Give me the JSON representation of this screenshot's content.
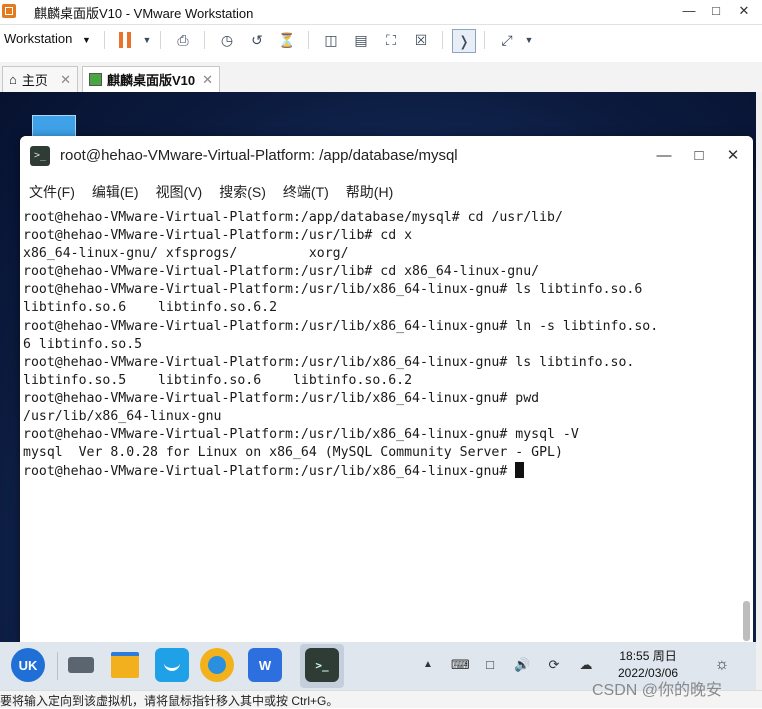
{
  "vmware": {
    "window_title": "麒麟桌面版V10 - VMware Workstation",
    "menu_label": "Workstation",
    "tabs": [
      {
        "label": "主页"
      },
      {
        "label": "麒麟桌面版V10"
      }
    ],
    "status_text": "要将输入定向到该虚拟机，请将鼠标指针移入其中或按 Ctrl+G。"
  },
  "terminal": {
    "title": "root@hehao-VMware-Virtual-Platform: /app/database/mysql",
    "menu": [
      "文件(F)",
      "编辑(E)",
      "视图(V)",
      "搜索(S)",
      "终端(T)",
      "帮助(H)"
    ],
    "lines": [
      "root@hehao-VMware-Virtual-Platform:/app/database/mysql# cd /usr/lib/",
      "root@hehao-VMware-Virtual-Platform:/usr/lib# cd x",
      "x86_64-linux-gnu/ xfsprogs/         xorg/",
      "root@hehao-VMware-Virtual-Platform:/usr/lib# cd x86_64-linux-gnu/",
      "root@hehao-VMware-Virtual-Platform:/usr/lib/x86_64-linux-gnu# ls libtinfo.so.6",
      "libtinfo.so.6    libtinfo.so.6.2",
      "root@hehao-VMware-Virtual-Platform:/usr/lib/x86_64-linux-gnu# ln -s libtinfo.so.",
      "6 libtinfo.so.5",
      "root@hehao-VMware-Virtual-Platform:/usr/lib/x86_64-linux-gnu# ls libtinfo.so.",
      "libtinfo.so.5    libtinfo.so.6    libtinfo.so.6.2",
      "root@hehao-VMware-Virtual-Platform:/usr/lib/x86_64-linux-gnu# pwd",
      "/usr/lib/x86_64-linux-gnu",
      "root@hehao-VMware-Virtual-Platform:/usr/lib/x86_64-linux-gnu# mysql -V",
      "mysql  Ver 8.0.28 for Linux on x86_64 (MySQL Community Server - GPL)"
    ],
    "prompt": "root@hehao-VMware-Virtual-Platform:/usr/lib/x86_64-linux-gnu# "
  },
  "taskbar": {
    "apps": [
      {
        "name": "uk-start",
        "label": "UK",
        "color": "#1f6fd6"
      },
      {
        "name": "file-manager",
        "label": "",
        "color": "#f2b01e"
      },
      {
        "name": "app-store",
        "label": "",
        "color": "#1fa1e8"
      },
      {
        "name": "browser",
        "label": "",
        "color": "#f3b21c"
      },
      {
        "name": "wps-writer",
        "label": "W",
        "color": "#2e6fe0"
      },
      {
        "name": "terminal-app",
        "label": ">_",
        "color": "#2f3b35"
      }
    ],
    "time": "18:55 周日",
    "date": "2022/03/06"
  },
  "watermark": "CSDN @你的晚安"
}
